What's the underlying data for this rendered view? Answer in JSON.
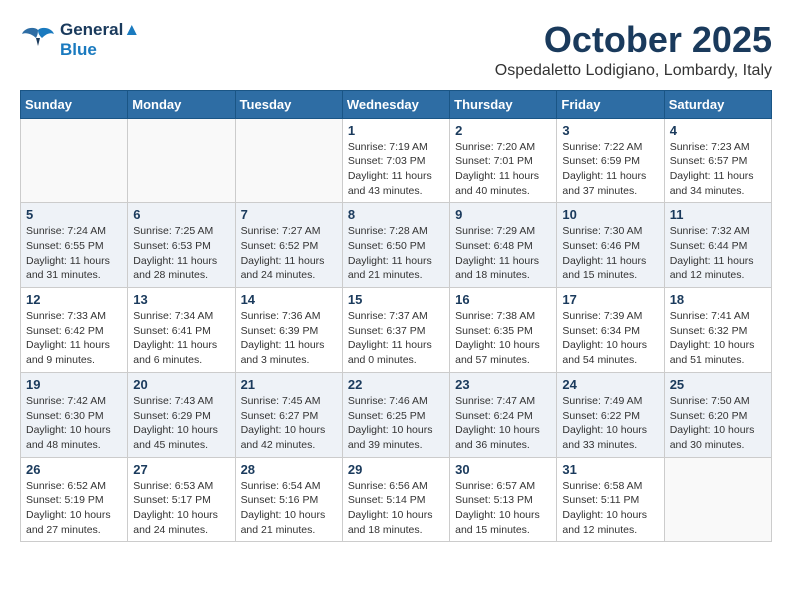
{
  "header": {
    "logo_line1": "General",
    "logo_line2": "Blue",
    "month": "October 2025",
    "location": "Ospedaletto Lodigiano, Lombardy, Italy"
  },
  "weekdays": [
    "Sunday",
    "Monday",
    "Tuesday",
    "Wednesday",
    "Thursday",
    "Friday",
    "Saturday"
  ],
  "weeks": [
    [
      {
        "day": "",
        "info": ""
      },
      {
        "day": "",
        "info": ""
      },
      {
        "day": "",
        "info": ""
      },
      {
        "day": "1",
        "info": "Sunrise: 7:19 AM\nSunset: 7:03 PM\nDaylight: 11 hours\nand 43 minutes."
      },
      {
        "day": "2",
        "info": "Sunrise: 7:20 AM\nSunset: 7:01 PM\nDaylight: 11 hours\nand 40 minutes."
      },
      {
        "day": "3",
        "info": "Sunrise: 7:22 AM\nSunset: 6:59 PM\nDaylight: 11 hours\nand 37 minutes."
      },
      {
        "day": "4",
        "info": "Sunrise: 7:23 AM\nSunset: 6:57 PM\nDaylight: 11 hours\nand 34 minutes."
      }
    ],
    [
      {
        "day": "5",
        "info": "Sunrise: 7:24 AM\nSunset: 6:55 PM\nDaylight: 11 hours\nand 31 minutes."
      },
      {
        "day": "6",
        "info": "Sunrise: 7:25 AM\nSunset: 6:53 PM\nDaylight: 11 hours\nand 28 minutes."
      },
      {
        "day": "7",
        "info": "Sunrise: 7:27 AM\nSunset: 6:52 PM\nDaylight: 11 hours\nand 24 minutes."
      },
      {
        "day": "8",
        "info": "Sunrise: 7:28 AM\nSunset: 6:50 PM\nDaylight: 11 hours\nand 21 minutes."
      },
      {
        "day": "9",
        "info": "Sunrise: 7:29 AM\nSunset: 6:48 PM\nDaylight: 11 hours\nand 18 minutes."
      },
      {
        "day": "10",
        "info": "Sunrise: 7:30 AM\nSunset: 6:46 PM\nDaylight: 11 hours\nand 15 minutes."
      },
      {
        "day": "11",
        "info": "Sunrise: 7:32 AM\nSunset: 6:44 PM\nDaylight: 11 hours\nand 12 minutes."
      }
    ],
    [
      {
        "day": "12",
        "info": "Sunrise: 7:33 AM\nSunset: 6:42 PM\nDaylight: 11 hours\nand 9 minutes."
      },
      {
        "day": "13",
        "info": "Sunrise: 7:34 AM\nSunset: 6:41 PM\nDaylight: 11 hours\nand 6 minutes."
      },
      {
        "day": "14",
        "info": "Sunrise: 7:36 AM\nSunset: 6:39 PM\nDaylight: 11 hours\nand 3 minutes."
      },
      {
        "day": "15",
        "info": "Sunrise: 7:37 AM\nSunset: 6:37 PM\nDaylight: 11 hours\nand 0 minutes."
      },
      {
        "day": "16",
        "info": "Sunrise: 7:38 AM\nSunset: 6:35 PM\nDaylight: 10 hours\nand 57 minutes."
      },
      {
        "day": "17",
        "info": "Sunrise: 7:39 AM\nSunset: 6:34 PM\nDaylight: 10 hours\nand 54 minutes."
      },
      {
        "day": "18",
        "info": "Sunrise: 7:41 AM\nSunset: 6:32 PM\nDaylight: 10 hours\nand 51 minutes."
      }
    ],
    [
      {
        "day": "19",
        "info": "Sunrise: 7:42 AM\nSunset: 6:30 PM\nDaylight: 10 hours\nand 48 minutes."
      },
      {
        "day": "20",
        "info": "Sunrise: 7:43 AM\nSunset: 6:29 PM\nDaylight: 10 hours\nand 45 minutes."
      },
      {
        "day": "21",
        "info": "Sunrise: 7:45 AM\nSunset: 6:27 PM\nDaylight: 10 hours\nand 42 minutes."
      },
      {
        "day": "22",
        "info": "Sunrise: 7:46 AM\nSunset: 6:25 PM\nDaylight: 10 hours\nand 39 minutes."
      },
      {
        "day": "23",
        "info": "Sunrise: 7:47 AM\nSunset: 6:24 PM\nDaylight: 10 hours\nand 36 minutes."
      },
      {
        "day": "24",
        "info": "Sunrise: 7:49 AM\nSunset: 6:22 PM\nDaylight: 10 hours\nand 33 minutes."
      },
      {
        "day": "25",
        "info": "Sunrise: 7:50 AM\nSunset: 6:20 PM\nDaylight: 10 hours\nand 30 minutes."
      }
    ],
    [
      {
        "day": "26",
        "info": "Sunrise: 6:52 AM\nSunset: 5:19 PM\nDaylight: 10 hours\nand 27 minutes."
      },
      {
        "day": "27",
        "info": "Sunrise: 6:53 AM\nSunset: 5:17 PM\nDaylight: 10 hours\nand 24 minutes."
      },
      {
        "day": "28",
        "info": "Sunrise: 6:54 AM\nSunset: 5:16 PM\nDaylight: 10 hours\nand 21 minutes."
      },
      {
        "day": "29",
        "info": "Sunrise: 6:56 AM\nSunset: 5:14 PM\nDaylight: 10 hours\nand 18 minutes."
      },
      {
        "day": "30",
        "info": "Sunrise: 6:57 AM\nSunset: 5:13 PM\nDaylight: 10 hours\nand 15 minutes."
      },
      {
        "day": "31",
        "info": "Sunrise: 6:58 AM\nSunset: 5:11 PM\nDaylight: 10 hours\nand 12 minutes."
      },
      {
        "day": "",
        "info": ""
      }
    ]
  ]
}
